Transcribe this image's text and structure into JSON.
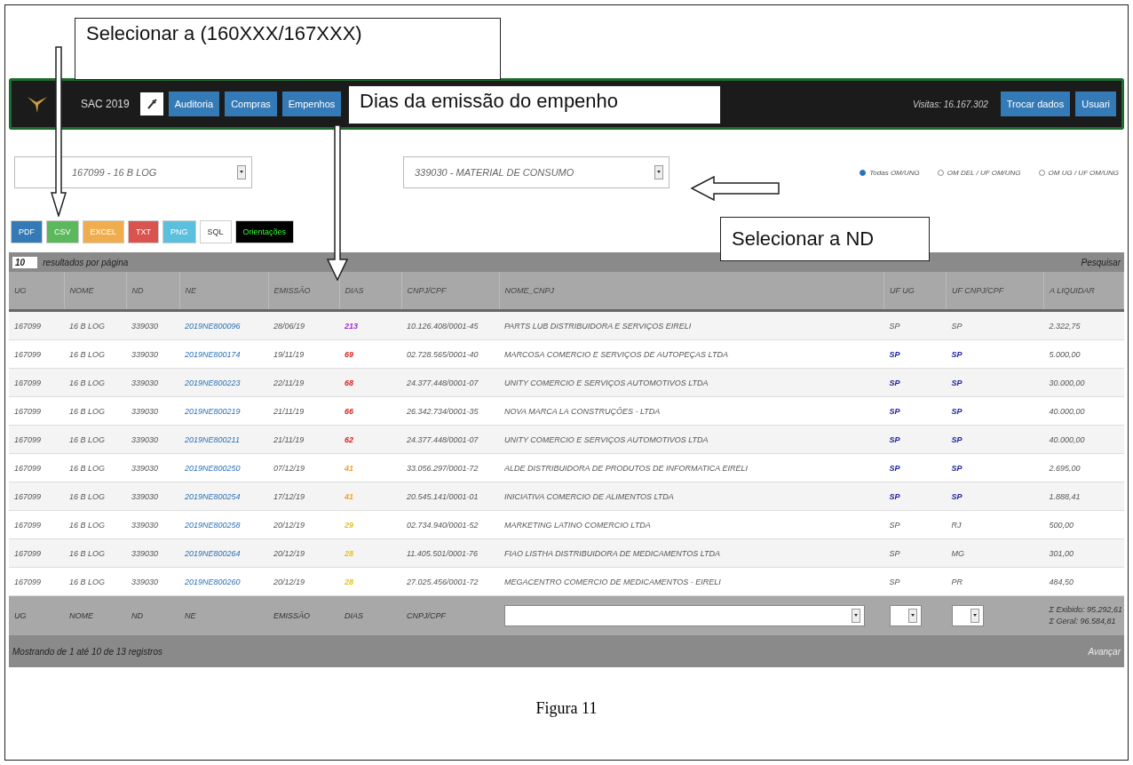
{
  "navbar": {
    "app_name": "SAC 2019",
    "buttons": [
      "Auditoria",
      "Compras",
      "Empenhos"
    ],
    "visits": "Visitas: 16.167.302",
    "right_buttons": [
      "Trocar dados",
      "Usuari"
    ]
  },
  "filters": {
    "ug_select": "167099 - 16 B LOG",
    "nd_select": "339030 - MATERIAL DE CONSUMO",
    "radios": [
      {
        "label": "Todas OM/UNG",
        "selected": true
      },
      {
        "label": "OM DEL / UF OM/UNG",
        "selected": false
      },
      {
        "label": "OM UG / UF OM/UNG",
        "selected": false
      }
    ]
  },
  "export_buttons": [
    {
      "label": "PDF",
      "color": "#337ab7"
    },
    {
      "label": "CSV",
      "color": "#5cb85c"
    },
    {
      "label": "EXCEL",
      "color": "#f0ad4e"
    },
    {
      "label": "TXT",
      "color": "#d9534f"
    },
    {
      "label": "PNG",
      "color": "#5bc0de"
    },
    {
      "label": "SQL",
      "color": "#ffffff"
    },
    {
      "label": "Orientações",
      "color": "#000000"
    }
  ],
  "length": {
    "value": "10",
    "label": "resultados por página"
  },
  "search_label": "Pesquisar",
  "table": {
    "columns": [
      "UG",
      "NOME",
      "ND",
      "NE",
      "EMISSÃO",
      "DIAS",
      "CNPJ/CPF",
      "NOME_CNPJ",
      "UF UG",
      "UF CNPJ/CPF",
      "A LIQUIDAR"
    ],
    "rows": [
      {
        "ug": "167099",
        "nome": "16 B LOG",
        "nd": "339030",
        "ne": "2019NE800096",
        "emissao": "28/06/19",
        "dias": "213",
        "color": "#9b30c8",
        "cnpj": "10.126.408/0001-45",
        "nome_cnpj": "PARTS LUB DISTRIBUIDORA E SERVIÇOS EIRELI",
        "uf_ug": "SP",
        "uf_cnpj": "SP",
        "uf_highlight": false,
        "a_liquidar": "2.322,75"
      },
      {
        "ug": "167099",
        "nome": "16 B LOG",
        "nd": "339030",
        "ne": "2019NE800174",
        "emissao": "19/11/19",
        "dias": "69",
        "color": "#d9231f",
        "cnpj": "02.728.565/0001-40",
        "nome_cnpj": "MARCOSA COMERCIO E SERVIÇOS DE AUTOPEÇAS LTDA",
        "uf_ug": "SP",
        "uf_cnpj": "SP",
        "uf_highlight": true,
        "a_liquidar": "5.000,00"
      },
      {
        "ug": "167099",
        "nome": "16 B LOG",
        "nd": "339030",
        "ne": "2019NE800223",
        "emissao": "22/11/19",
        "dias": "68",
        "color": "#d9231f",
        "cnpj": "24.377.448/0001-07",
        "nome_cnpj": "UNITY COMERCIO E SERVIÇOS AUTOMOTIVOS LTDA",
        "uf_ug": "SP",
        "uf_cnpj": "SP",
        "uf_highlight": true,
        "a_liquidar": "30.000,00"
      },
      {
        "ug": "167099",
        "nome": "16 B LOG",
        "nd": "339030",
        "ne": "2019NE800219",
        "emissao": "21/11/19",
        "dias": "66",
        "color": "#d9231f",
        "cnpj": "26.342.734/0001-35",
        "nome_cnpj": "NOVA MARCA LA CONSTRUÇÕES - LTDA",
        "uf_ug": "SP",
        "uf_cnpj": "SP",
        "uf_highlight": true,
        "a_liquidar": "40.000,00"
      },
      {
        "ug": "167099",
        "nome": "16 B LOG",
        "nd": "339030",
        "ne": "2019NE800211",
        "emissao": "21/11/19",
        "dias": "62",
        "color": "#d9231f",
        "cnpj": "24.377.448/0001-07",
        "nome_cnpj": "UNITY COMERCIO E SERVIÇOS AUTOMOTIVOS LTDA",
        "uf_ug": "SP",
        "uf_cnpj": "SP",
        "uf_highlight": true,
        "a_liquidar": "40.000,00"
      },
      {
        "ug": "167099",
        "nome": "16 B LOG",
        "nd": "339030",
        "ne": "2019NE800250",
        "emissao": "07/12/19",
        "dias": "41",
        "color": "#f0a030",
        "cnpj": "33.056.297/0001-72",
        "nome_cnpj": "ALDE DISTRIBUIDORA DE PRODUTOS DE INFORMATICA EIRELI",
        "uf_ug": "SP",
        "uf_cnpj": "SP",
        "uf_highlight": true,
        "a_liquidar": "2.695,00"
      },
      {
        "ug": "167099",
        "nome": "16 B LOG",
        "nd": "339030",
        "ne": "2019NE800254",
        "emissao": "17/12/19",
        "dias": "41",
        "color": "#f0a030",
        "cnpj": "20.545.141/0001-01",
        "nome_cnpj": "INICIATIVA COMERCIO DE ALIMENTOS LTDA",
        "uf_ug": "SP",
        "uf_cnpj": "SP",
        "uf_highlight": true,
        "a_liquidar": "1.888,41"
      },
      {
        "ug": "167099",
        "nome": "16 B LOG",
        "nd": "339030",
        "ne": "2019NE800258",
        "emissao": "20/12/19",
        "dias": "29",
        "color": "#e8c020",
        "cnpj": "02.734.940/0001-52",
        "nome_cnpj": "MARKETING LATINO COMERCIO LTDA",
        "uf_ug": "SP",
        "uf_cnpj": "RJ",
        "uf_highlight": false,
        "a_liquidar": "500,00"
      },
      {
        "ug": "167099",
        "nome": "16 B LOG",
        "nd": "339030",
        "ne": "2019NE800264",
        "emissao": "20/12/19",
        "dias": "28",
        "color": "#e8c020",
        "cnpj": "11.405.501/0001-76",
        "nome_cnpj": "FIAO LISTHA DISTRIBUIDORA DE MEDICAMENTOS LTDA",
        "uf_ug": "SP",
        "uf_cnpj": "MG",
        "uf_highlight": false,
        "a_liquidar": "301,00"
      },
      {
        "ug": "167099",
        "nome": "16 B LOG",
        "nd": "339030",
        "ne": "2019NE800260",
        "emissao": "20/12/19",
        "dias": "28",
        "color": "#e8c020",
        "cnpj": "27.025.456/0001-72",
        "nome_cnpj": "MEGACENTRO COMERCIO DE MEDICAMENTOS - EIRELI",
        "uf_ug": "SP",
        "uf_cnpj": "PR",
        "uf_highlight": false,
        "a_liquidar": "484,50"
      }
    ],
    "footer": {
      "labels": [
        "UG",
        "NOME",
        "ND",
        "NE",
        "EMISSÃO",
        "DIAS",
        "CNPJ/CPF"
      ],
      "total_shown": "Σ Exibido: 95.292,61",
      "total_all": "Σ Geral: 96.584,81"
    },
    "info": "Mostrando de 1 até 10 de 13 registros",
    "next": "Avançar"
  },
  "callouts": [
    "Selecionar a (160XXX/167XXX)",
    "Dias da emissão do empenho",
    "Selecionar a ND"
  ],
  "caption": "Figura 11"
}
